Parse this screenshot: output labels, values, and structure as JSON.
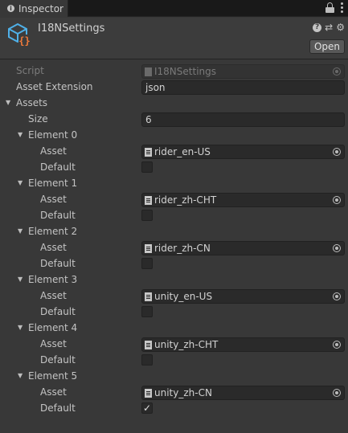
{
  "tab": {
    "title": "Inspector"
  },
  "header": {
    "asset_name": "I18NSettings",
    "open_label": "Open",
    "help_glyph": "?",
    "preset_glyph": "⇄",
    "gear_glyph": "⚙"
  },
  "script": {
    "label": "Script",
    "value": "I18NSettings"
  },
  "asset_extension": {
    "label": "Asset Extension",
    "value": "json"
  },
  "assets": {
    "label": "Assets",
    "size_label": "Size",
    "size_value": "6",
    "elements": [
      {
        "label": "Element 0",
        "asset_label": "Asset",
        "asset_value": "rider_en-US",
        "default_label": "Default",
        "default_checked": false
      },
      {
        "label": "Element 1",
        "asset_label": "Asset",
        "asset_value": "rider_zh-CHT",
        "default_label": "Default",
        "default_checked": false
      },
      {
        "label": "Element 2",
        "asset_label": "Asset",
        "asset_value": "rider_zh-CN",
        "default_label": "Default",
        "default_checked": false
      },
      {
        "label": "Element 3",
        "asset_label": "Asset",
        "asset_value": "unity_en-US",
        "default_label": "Default",
        "default_checked": false
      },
      {
        "label": "Element 4",
        "asset_label": "Asset",
        "asset_value": "unity_zh-CHT",
        "default_label": "Default",
        "default_checked": false
      },
      {
        "label": "Element 5",
        "asset_label": "Asset",
        "asset_value": "unity_zh-CN",
        "default_label": "Default",
        "default_checked": true
      }
    ]
  },
  "colors": {
    "background": "#383838",
    "field_bg": "#2a2a2a",
    "icon_blue": "#4fb0e8",
    "icon_orange": "#f07a3a"
  }
}
